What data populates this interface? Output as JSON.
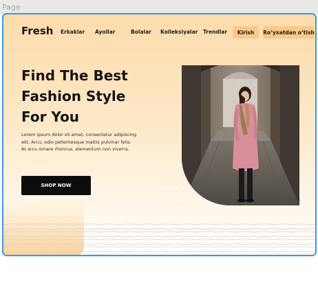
{
  "editor": {
    "page_label": "Page"
  },
  "nav": {
    "logo": "Fresh",
    "links": [
      {
        "label": "Erkaklar"
      },
      {
        "label": "Ayollar"
      },
      {
        "label": "Bolalar"
      },
      {
        "label": "Kolleksiyalar"
      },
      {
        "label": "Trendlar"
      }
    ],
    "login_label": "Kirish",
    "register_label": "Ro‘yxatdan o‘tish"
  },
  "hero": {
    "title_lines": [
      "Find The Best",
      "Fashion Style",
      "For You"
    ],
    "description": "Lorem ipsum dolor sit amet, consectetur adipiscing elit. Arcu, odio pellentesque mattis pulvinar felis. At arcu ornare rhoncus, elementum non viverra.",
    "cta_label": "SHOP NOW"
  },
  "colors": {
    "accent": "#f8c98a",
    "selection_border": "#3b97e6",
    "button_dark": "#0d0d0d",
    "text_dark": "#151515"
  },
  "icons": {
    "dot_grid": "decorative-dot-pattern",
    "wave_lines": "decorative-wave-lines"
  }
}
